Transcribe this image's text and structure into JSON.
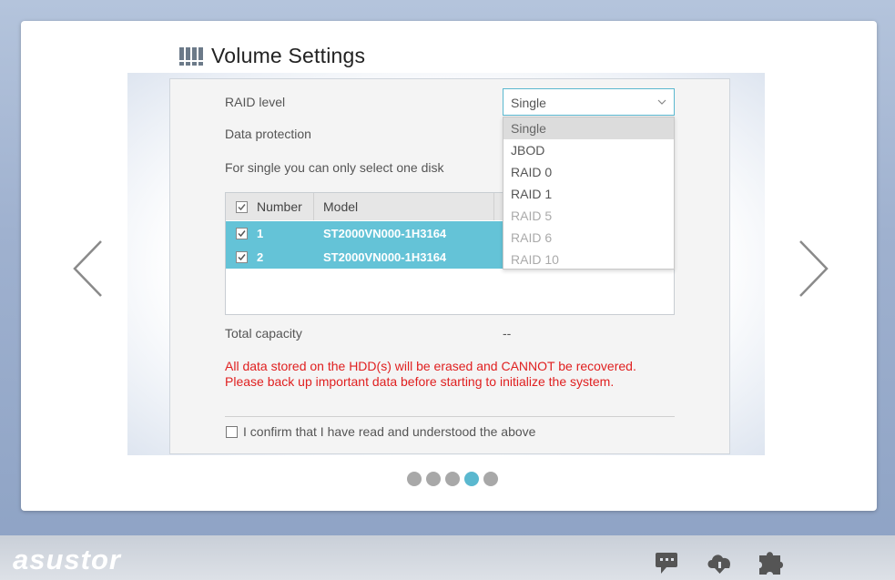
{
  "page_title": "Volume Settings",
  "form": {
    "raid_level_label": "RAID level",
    "data_protection_label": "Data protection",
    "single_note": "For single you can only select one disk",
    "raid_select_value": "Single",
    "raid_options": [
      {
        "label": "Single",
        "state": "selected"
      },
      {
        "label": "JBOD",
        "state": "enabled"
      },
      {
        "label": "RAID 0",
        "state": "enabled"
      },
      {
        "label": "RAID 1",
        "state": "enabled"
      },
      {
        "label": "RAID 5",
        "state": "disabled"
      },
      {
        "label": "RAID 6",
        "state": "disabled"
      },
      {
        "label": "RAID 10",
        "state": "disabled"
      }
    ]
  },
  "disk_table": {
    "headers": {
      "number": "Number",
      "model": "Model"
    },
    "rows": [
      {
        "number": "1",
        "model": "ST2000VN000-1H3164",
        "checked": true
      },
      {
        "number": "2",
        "model": "ST2000VN000-1H3164",
        "checked": true
      }
    ]
  },
  "capacity": {
    "label": "Total capacity",
    "value": "--"
  },
  "warning": {
    "line1": "All data stored on the HDD(s) will be erased and CANNOT be recovered.",
    "line2": "Please back up important data before starting to initialize the system."
  },
  "confirm": {
    "label": "I confirm that I have read and understood the above",
    "checked": false
  },
  "pager": {
    "total": 5,
    "active_index": 3
  },
  "brand": {
    "logo_text": "asustor"
  },
  "colors": {
    "accent": "#5ab8cf",
    "row_highlight": "#64c3d7",
    "warning": "#e02020"
  },
  "tray_icons": [
    "chat-icon",
    "cloud-download-icon",
    "puzzle-icon"
  ]
}
